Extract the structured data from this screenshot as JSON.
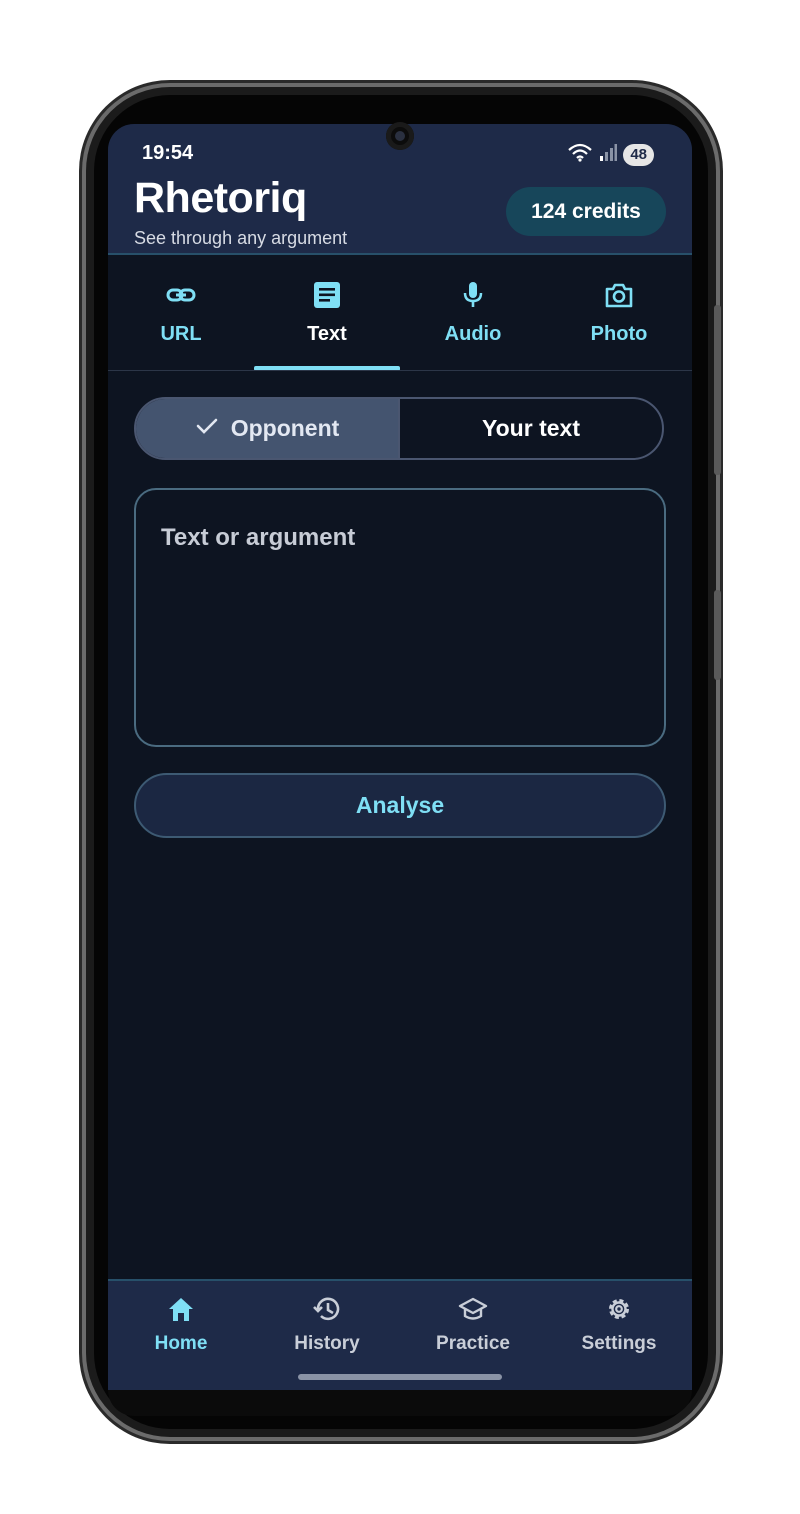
{
  "status_bar": {
    "time": "19:54",
    "battery": "48"
  },
  "header": {
    "title": "Rhetoriq",
    "subtitle": "See through any argument",
    "credits": "124 credits"
  },
  "input_tabs": [
    {
      "label": "URL",
      "icon": "link-icon"
    },
    {
      "label": "Text",
      "icon": "document-icon",
      "active": true
    },
    {
      "label": "Audio",
      "icon": "microphone-icon"
    },
    {
      "label": "Photo",
      "icon": "camera-icon"
    }
  ],
  "source_toggle": {
    "options": [
      "Opponent",
      "Your text"
    ],
    "selected": "Opponent"
  },
  "text_input": {
    "placeholder": "Text or argument",
    "value": ""
  },
  "analyse_button": {
    "label": "Analyse"
  },
  "bottom_nav": [
    {
      "label": "Home",
      "icon": "home-icon",
      "active": true
    },
    {
      "label": "History",
      "icon": "history-icon"
    },
    {
      "label": "Practice",
      "icon": "graduation-cap-icon"
    },
    {
      "label": "Settings",
      "icon": "gear-icon"
    }
  ],
  "colors": {
    "accent": "#7fdff5",
    "header": "#1e2a48",
    "background": "#0d1421",
    "credits_pill": "#17465a"
  }
}
